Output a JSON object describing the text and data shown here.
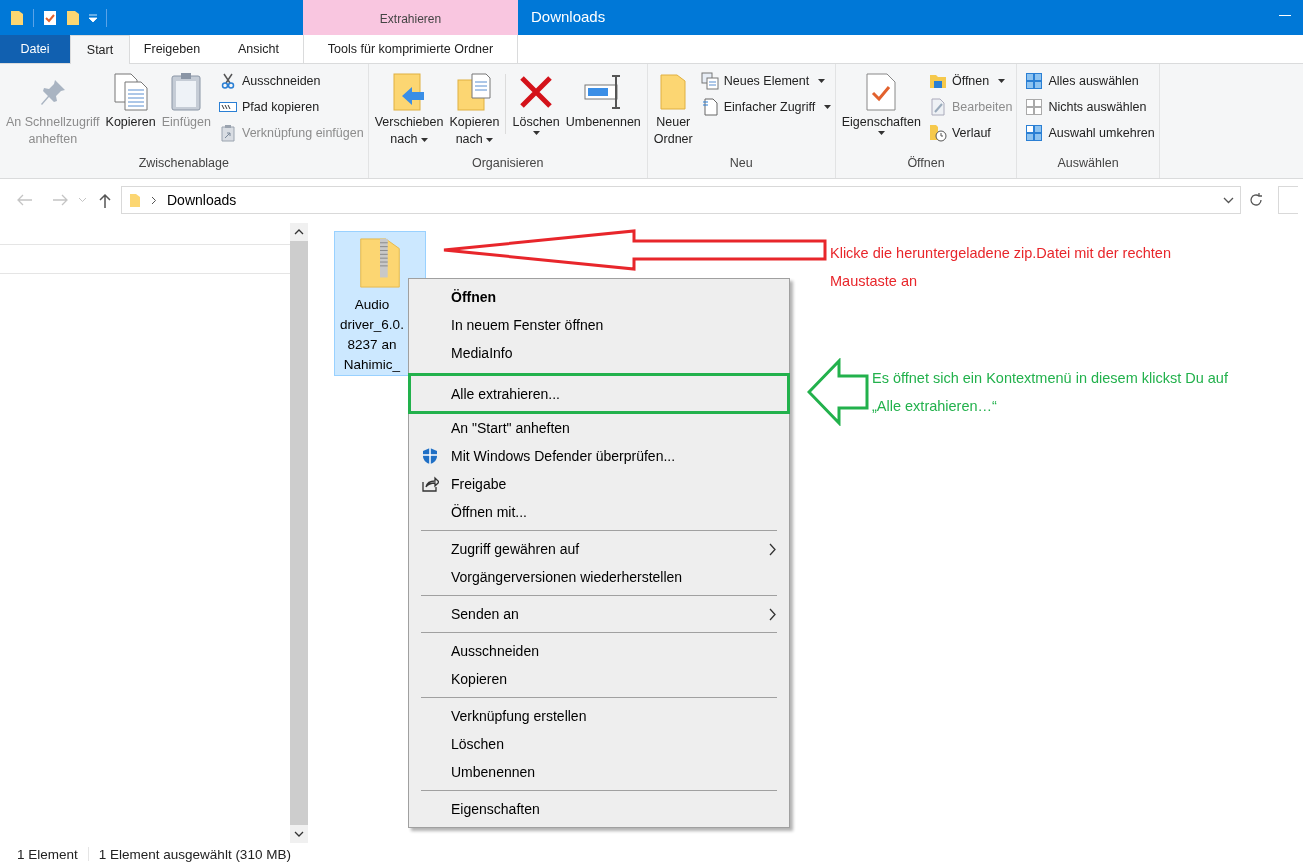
{
  "title_bar": {
    "context_tab": "Extrahieren",
    "title": "Downloads"
  },
  "tabs": [
    {
      "label": "Datei",
      "kind": "file",
      "selected": false
    },
    {
      "label": "Start",
      "kind": "tab",
      "selected": true
    },
    {
      "label": "Freigeben",
      "kind": "tab",
      "selected": false
    },
    {
      "label": "Ansicht",
      "kind": "tab",
      "selected": false
    },
    {
      "label": "Tools für komprimierte Ordner",
      "kind": "context",
      "selected": false
    }
  ],
  "ribbon_groups": [
    {
      "title": "Zwischenablage",
      "large": [
        {
          "label": [
            "An Schnellzugriff",
            "anheften"
          ],
          "disabled": true,
          "has_menu": false
        },
        {
          "label": [
            "Kopieren"
          ],
          "disabled": false,
          "has_menu": false
        },
        {
          "label": [
            "Einfügen"
          ],
          "disabled": true,
          "has_menu": false
        }
      ],
      "small": [
        {
          "label": "Ausschneiden",
          "disabled": false,
          "has_menu": false
        },
        {
          "label": "Pfad kopieren",
          "disabled": false,
          "has_menu": false
        },
        {
          "label": "Verknüpfung einfügen",
          "disabled": true,
          "has_menu": false
        }
      ]
    },
    {
      "title": "Organisieren",
      "large": [
        {
          "label": [
            "Verschieben",
            "nach"
          ],
          "disabled": false,
          "has_menu": true
        },
        {
          "label": [
            "Kopieren",
            "nach"
          ],
          "disabled": false,
          "has_menu": true
        },
        {
          "label": [
            "Löschen"
          ],
          "disabled": false,
          "has_menu": true
        },
        {
          "label": [
            "Umbenennen"
          ],
          "disabled": false,
          "has_menu": false
        }
      ]
    },
    {
      "title": "Neu",
      "large": [
        {
          "label": [
            "Neuer",
            "Ordner"
          ],
          "disabled": false,
          "has_menu": false
        }
      ],
      "small": [
        {
          "label": "Neues Element",
          "disabled": false,
          "has_menu": true
        },
        {
          "label": "Einfacher Zugriff",
          "disabled": false,
          "has_menu": true
        }
      ]
    },
    {
      "title": "Öffnen",
      "large": [
        {
          "label": [
            "Eigenschaften"
          ],
          "disabled": false,
          "has_menu": true
        }
      ],
      "small": [
        {
          "label": "Öffnen",
          "disabled": false,
          "has_menu": true
        },
        {
          "label": "Bearbeiten",
          "disabled": true,
          "has_menu": false
        },
        {
          "label": "Verlauf",
          "disabled": false,
          "has_menu": false
        }
      ]
    },
    {
      "title": "Auswählen",
      "small": [
        {
          "label": "Alles auswählen",
          "disabled": false,
          "has_menu": false
        },
        {
          "label": "Nichts auswählen",
          "disabled": false,
          "has_menu": false
        },
        {
          "label": "Auswahl umkehren",
          "disabled": false,
          "has_menu": false
        }
      ]
    }
  ],
  "address_bar": {
    "path": "Downloads"
  },
  "file": {
    "label": [
      "Audio",
      "driver_6.0.",
      "8237 an",
      "Nahimic_"
    ],
    "selected": true
  },
  "context_menu": [
    {
      "kind": "item",
      "label": "Öffnen",
      "default": true,
      "submenu": false,
      "annotated": false
    },
    {
      "kind": "item",
      "label": "In neuem Fenster öffnen",
      "default": false,
      "submenu": false,
      "annotated": false
    },
    {
      "kind": "item",
      "label": "MediaInfo",
      "default": false,
      "submenu": false,
      "annotated": false
    },
    {
      "kind": "item",
      "label": "Alle extrahieren...",
      "default": false,
      "submenu": false,
      "annotated": true
    },
    {
      "kind": "item",
      "label": "An \"Start\" anheften",
      "default": false,
      "submenu": false,
      "annotated": false
    },
    {
      "kind": "item",
      "label": "Mit Windows Defender überprüfen...",
      "default": false,
      "submenu": false,
      "annotated": false
    },
    {
      "kind": "item",
      "label": "Freigabe",
      "default": false,
      "submenu": false,
      "annotated": false
    },
    {
      "kind": "item",
      "label": "Öffnen mit...",
      "default": false,
      "submenu": false,
      "annotated": false
    },
    {
      "kind": "separator"
    },
    {
      "kind": "item",
      "label": "Zugriff gewähren auf",
      "default": false,
      "submenu": true,
      "annotated": false
    },
    {
      "kind": "item",
      "label": "Vorgängerversionen wiederherstellen",
      "default": false,
      "submenu": false,
      "annotated": false
    },
    {
      "kind": "separator"
    },
    {
      "kind": "item",
      "label": "Senden an",
      "default": false,
      "submenu": true,
      "annotated": false
    },
    {
      "kind": "separator"
    },
    {
      "kind": "item",
      "label": "Ausschneiden",
      "default": false,
      "submenu": false,
      "annotated": false
    },
    {
      "kind": "item",
      "label": "Kopieren",
      "default": false,
      "submenu": false,
      "annotated": false
    },
    {
      "kind": "separator"
    },
    {
      "kind": "item",
      "label": "Verknüpfung erstellen",
      "default": false,
      "submenu": false,
      "annotated": false
    },
    {
      "kind": "item",
      "label": "Löschen",
      "default": false,
      "submenu": false,
      "annotated": false
    },
    {
      "kind": "item",
      "label": "Umbenennen",
      "default": false,
      "submenu": false,
      "annotated": false
    },
    {
      "kind": "separator"
    },
    {
      "kind": "item",
      "label": "Eigenschaften",
      "default": false,
      "submenu": false,
      "annotated": false
    }
  ],
  "annotations": [
    {
      "text": "Klicke die heruntergeladene zip.Datei mit der rechten Maustaste an",
      "color": "#e8262b"
    },
    {
      "text": "Es öffnet sich ein Kontextmenü in diesem klickst Du auf „Alle extrahieren…“",
      "color": "#22b14c"
    }
  ],
  "status_bar": [
    "1 Element",
    "1 Element ausgewählt (310 MB)"
  ]
}
